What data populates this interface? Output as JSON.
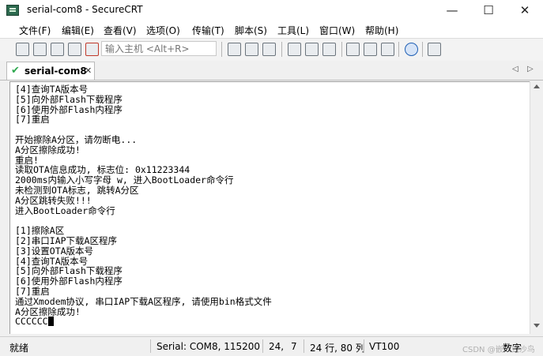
{
  "window": {
    "title": "serial-com8 - SecureCRT",
    "min": "—",
    "max": "☐",
    "close": "✕"
  },
  "menu": [
    "文件(F)",
    "编辑(E)",
    "查看(V)",
    "选项(O)",
    "传输(T)",
    "脚本(S)",
    "工具(L)",
    "窗口(W)",
    "帮助(H)"
  ],
  "toolbar": {
    "host_placeholder": "输入主机 <Alt+R>"
  },
  "tabs": [
    {
      "label": "serial-com8",
      "active": true
    }
  ],
  "terminal": {
    "lines": [
      "[4]查询TA版本号",
      "[5]向外部Flash下载程序",
      "[6]使用外部Flash内程序",
      "[7]重启",
      "",
      "开始擦除A分区，请勿断电...",
      "A分区擦除成功!",
      "重启!",
      "读取OTA信息成功, 标志位: 0x11223344",
      "2000ms内输入小写字母 w, 进入BootLoader命令行",
      "未检测到OTA标志, 跳转A分区",
      "A分区跳转失败!!!",
      "进入BootLoader命令行",
      "",
      "[1]擦除A区",
      "[2]串口IAP下载A区程序",
      "[3]设置OTA版本号",
      "[4]查询TA版本号",
      "[5]向外部Flash下载程序",
      "[6]使用外部Flash内程序",
      "[7]重启",
      "通过Xmodem协议, 串口IAP下载A区程序, 请使用bin格式文件",
      "A分区擦除成功!",
      "CCCCCC"
    ]
  },
  "status": {
    "ready": "就绪",
    "connection": "Serial: COM8, 115200",
    "row": "24,",
    "col": "7",
    "size": "24 行, 80 列",
    "emulation": "VT100",
    "watermark": "CSDN @嵌入式沙鸟",
    "numlock": "数字"
  },
  "colors": {
    "terminal_bg": "#ffffff",
    "chrome_bg": "#f0f0f0",
    "tab_check": "#2fa84f"
  }
}
